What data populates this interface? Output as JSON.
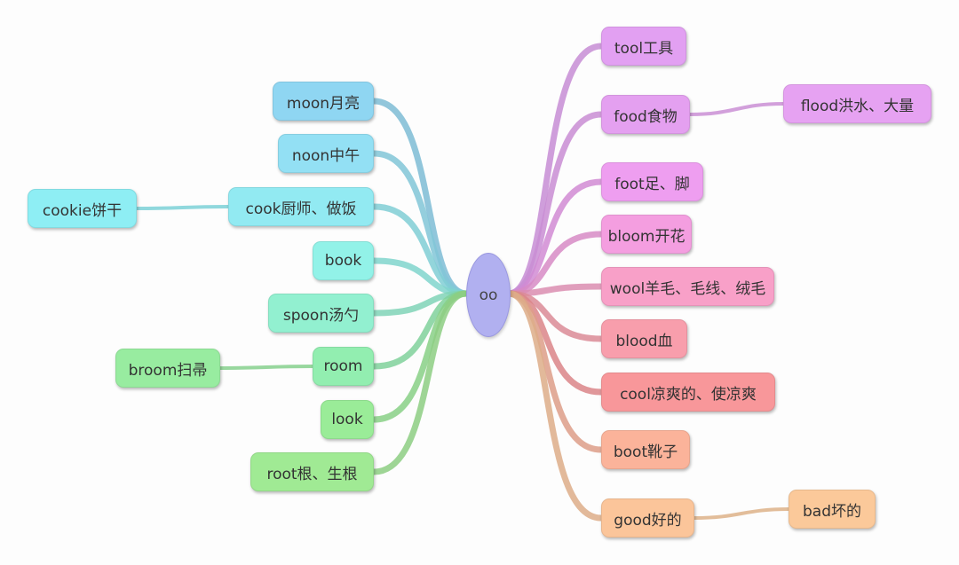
{
  "center": {
    "label": "oo",
    "color": "#b1b0f0"
  },
  "left": [
    {
      "label": "moon月亮",
      "color": "#8fd6f2"
    },
    {
      "label": "noon中午",
      "color": "#93e0f4"
    },
    {
      "label": "cook厨师、做饭",
      "color": "#92eaf2",
      "child": {
        "label": "cookie饼干",
        "color": "#8eeef4"
      }
    },
    {
      "label": "book",
      "color": "#92f2e8"
    },
    {
      "label": "spoon汤勺",
      "color": "#92f0d0"
    },
    {
      "label": "room",
      "color": "#92eeb0",
      "child": {
        "label": "broom扫帚",
        "color": "#98eca0"
      }
    },
    {
      "label": "look",
      "color": "#9aec98"
    },
    {
      "label": "root根、生根",
      "color": "#a0ea94"
    }
  ],
  "right": [
    {
      "label": "tool工具",
      "color": "#e2a0f2"
    },
    {
      "label": "food食物",
      "color": "#e4a0f0",
      "child": {
        "label": "flood洪水、大量",
        "color": "#e6a2f2"
      }
    },
    {
      "label": "foot足、脚",
      "color": "#ee9ef0"
    },
    {
      "label": "bloom开花",
      "color": "#f49ee0"
    },
    {
      "label": "wool羊毛、毛线、绒毛",
      "color": "#f8a0c8"
    },
    {
      "label": "blood血",
      "color": "#f89eac"
    },
    {
      "label": "cool凉爽的、使凉爽",
      "color": "#f8979a"
    },
    {
      "label": "boot靴子",
      "color": "#fbb39a"
    },
    {
      "label": "good好的",
      "color": "#fbc59a",
      "child": {
        "label": "bad坏的",
        "color": "#fbc99a"
      }
    }
  ]
}
